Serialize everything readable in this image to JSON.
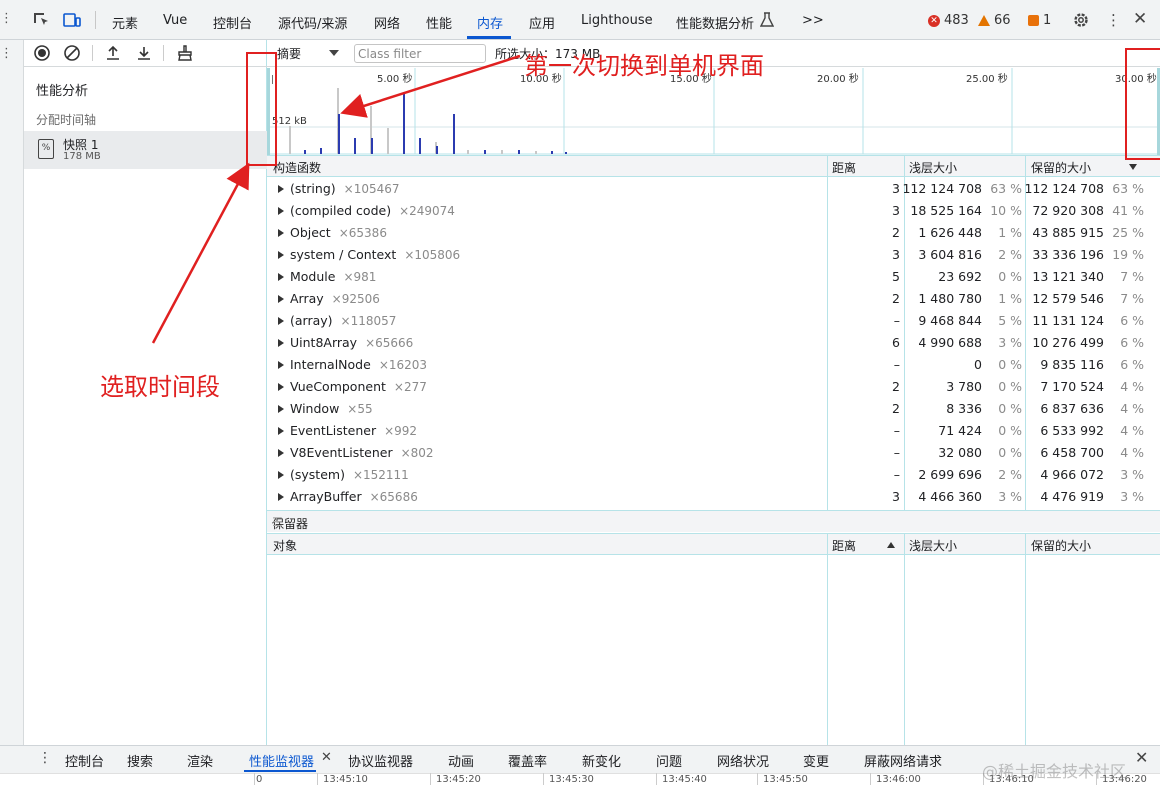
{
  "topbar": {
    "tabs": [
      "元素",
      "Vue",
      "控制台",
      "源代码/来源",
      "网络",
      "性能",
      "内存",
      "应用",
      "Lighthouse",
      "性能数据分析"
    ],
    "active_tab": "内存",
    "more": ">>",
    "errors": "483",
    "warnings": "66",
    "issues": "1"
  },
  "sidebar": {
    "title": "性能分析",
    "subtitle": "分配时间轴",
    "snapshot_name": "快照 1",
    "snapshot_size": "178 MB"
  },
  "filterbar": {
    "view": "摘要",
    "class_filter_placeholder": "Class filter",
    "selected_size": "所选大小：173 MB"
  },
  "timeline": {
    "ticks": [
      "5.00 秒",
      "10.00 秒",
      "15.00 秒",
      "20.00 秒",
      "25.00 秒",
      "30.00 秒"
    ],
    "scale_label": "512 kB"
  },
  "summary_headers": {
    "constructor": "构造函数",
    "distance": "距离",
    "shallow": "浅层大小",
    "retained": "保留的大小"
  },
  "summary_rows": [
    {
      "name": "(string)",
      "count": "×105467",
      "distance": "3",
      "shallow": "112 124 708",
      "shallow_pct": "63 %",
      "retained": "112 124 708",
      "retained_pct": "63 %"
    },
    {
      "name": "(compiled code)",
      "count": "×249074",
      "distance": "3",
      "shallow": "18 525 164",
      "shallow_pct": "10 %",
      "retained": "72 920 308",
      "retained_pct": "41 %"
    },
    {
      "name": "Object",
      "count": "×65386",
      "distance": "2",
      "shallow": "1 626 448",
      "shallow_pct": "1 %",
      "retained": "43 885 915",
      "retained_pct": "25 %"
    },
    {
      "name": "system / Context",
      "count": "×105806",
      "distance": "3",
      "shallow": "3 604 816",
      "shallow_pct": "2 %",
      "retained": "33 336 196",
      "retained_pct": "19 %"
    },
    {
      "name": "Module",
      "count": "×981",
      "distance": "5",
      "shallow": "23 692",
      "shallow_pct": "0 %",
      "retained": "13 121 340",
      "retained_pct": "7 %"
    },
    {
      "name": "Array",
      "count": "×92506",
      "distance": "2",
      "shallow": "1 480 780",
      "shallow_pct": "1 %",
      "retained": "12 579 546",
      "retained_pct": "7 %"
    },
    {
      "name": "(array)",
      "count": "×118057",
      "distance": "–",
      "shallow": "9 468 844",
      "shallow_pct": "5 %",
      "retained": "11 131 124",
      "retained_pct": "6 %"
    },
    {
      "name": "Uint8Array",
      "count": "×65666",
      "distance": "6",
      "shallow": "4 990 688",
      "shallow_pct": "3 %",
      "retained": "10 276 499",
      "retained_pct": "6 %"
    },
    {
      "name": "InternalNode",
      "count": "×16203",
      "distance": "–",
      "shallow": "0",
      "shallow_pct": "0 %",
      "retained": "9 835 116",
      "retained_pct": "6 %"
    },
    {
      "name": "VueComponent",
      "count": "×277",
      "distance": "2",
      "shallow": "3 780",
      "shallow_pct": "0 %",
      "retained": "7 170 524",
      "retained_pct": "4 %"
    },
    {
      "name": "Window",
      "count": "×55",
      "distance": "2",
      "shallow": "8 336",
      "shallow_pct": "0 %",
      "retained": "6 837 636",
      "retained_pct": "4 %"
    },
    {
      "name": "EventListener",
      "count": "×992",
      "distance": "–",
      "shallow": "71 424",
      "shallow_pct": "0 %",
      "retained": "6 533 992",
      "retained_pct": "4 %"
    },
    {
      "name": "V8EventListener",
      "count": "×802",
      "distance": "–",
      "shallow": "32 080",
      "shallow_pct": "0 %",
      "retained": "6 458 700",
      "retained_pct": "4 %"
    },
    {
      "name": "(system)",
      "count": "×152111",
      "distance": "–",
      "shallow": "2 699 696",
      "shallow_pct": "2 %",
      "retained": "4 966 072",
      "retained_pct": "3 %"
    },
    {
      "name": "ArrayBuffer",
      "count": "×65686",
      "distance": "3",
      "shallow": "4 466 360",
      "shallow_pct": "3 %",
      "retained": "4 476 919",
      "retained_pct": "3 %"
    }
  ],
  "retainers": {
    "title": "保留器",
    "headers": {
      "object": "对象",
      "distance": "距离",
      "shallow": "浅层大小",
      "retained": "保留的大小"
    }
  },
  "drawer": {
    "tabs": [
      "控制台",
      "搜索",
      "渲染",
      "性能监视器",
      "协议监视器",
      "动画",
      "覆盖率",
      "新变化",
      "问题",
      "网络状况",
      "变更",
      "屏蔽网络请求"
    ],
    "active_tab": "性能监视器",
    "ticks": [
      "0",
      "13:45:10",
      "13:45:20",
      "13:45:30",
      "13:45:40",
      "13:45:50",
      "13:46:00",
      "13:46:10",
      "13:46:20"
    ],
    "watermark": "@稀土掘金技术社区"
  },
  "annotations": {
    "first_switch": "第一次切换到单机界面",
    "select_range": "选取时间段"
  },
  "colors": {
    "accent": "#0b57d0",
    "annotation": "#e02020",
    "grid_line": "#b6e3e8"
  }
}
